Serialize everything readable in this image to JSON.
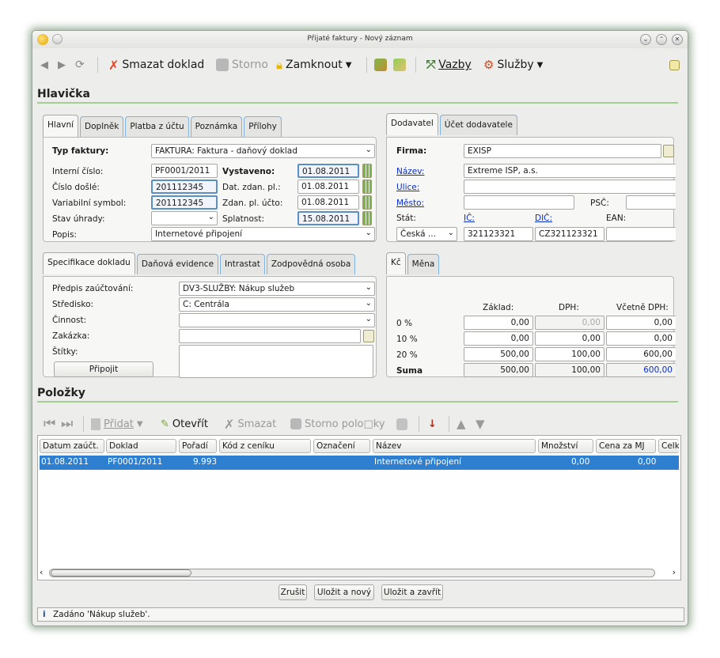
{
  "window": {
    "title": "Přijaté faktury - Nový záznam"
  },
  "toolbar": {
    "delete": "Smazat doklad",
    "storno": "Storno",
    "lock": "Zamknout",
    "links": "Vazby",
    "services": "Služby"
  },
  "header": {
    "title": "Hlavička",
    "left_tabs": [
      "Hlavní",
      "Doplněk",
      "Platba z účtu",
      "Poznámka",
      "Přílohy"
    ],
    "right_tabs": [
      "Dodavatel",
      "Účet dodavatele"
    ],
    "fields": {
      "typ_label": "Typ faktury:",
      "typ_value": "FAKTURA: Faktura - daňový doklad",
      "interni_label": "Interní číslo:",
      "interni_value": "PF0001/2011",
      "vystaveno_label": "Vystaveno:",
      "vystaveno_value": "01.08.2011",
      "cislo_dosle_label": "Číslo došlé:",
      "cislo_dosle_value": "201112345",
      "dat_zdan_label": "Dat. zdan. pl.:",
      "dat_zdan_value": "01.08.2011",
      "vs_label": "Variabilní symbol:",
      "vs_value": "201112345",
      "zdan_ucto_label": "Zdan. pl. účto:",
      "zdan_ucto_value": "01.08.2011",
      "stav_label": "Stav úhrady:",
      "stav_value": "",
      "splatnost_label": "Splatnost:",
      "splatnost_value": "15.08.2011",
      "popis_label": "Popis:",
      "popis_value": "Internetové připojení"
    },
    "supplier": {
      "firma_label": "Firma:",
      "firma_value": "EXISP",
      "nazev_label": "Název:",
      "nazev_value": "Extreme ISP, a.s.",
      "ulice_label": "Ulice:",
      "mesto_label": "Město:",
      "psc_label": "PSČ:",
      "stat_label": "Stát:",
      "ic_label": "IČ:",
      "dic_label": "DIČ:",
      "ean_label": "EAN:",
      "stat_value": "Česká ...",
      "ic_value": "321123321",
      "dic_value": "CZ321123321"
    },
    "spec_tabs": [
      "Specifikace dokladu",
      "Daňová evidence",
      "Intrastat",
      "Zodpovědná osoba"
    ],
    "spec": {
      "predpis_label": "Předpis zaúčtování:",
      "predpis_value": "DV3-SLUŽBY: Nákup služeb",
      "stredisko_label": "Středisko:",
      "stredisko_value": "C: Centrála",
      "cinnost_label": "Činnost:",
      "zakazka_label": "Zakázka:",
      "stitky_label": "Štítky:",
      "pripojit": "Připojit"
    },
    "vat_tabs": [
      "Kč",
      "Měna"
    ],
    "vat": {
      "col_zaklad": "Základ:",
      "col_dph": "DPH:",
      "col_celkem": "Včetně DPH:",
      "rows": [
        {
          "label": "0 %",
          "zaklad": "0,00",
          "dph": "0,00",
          "celkem": "0,00"
        },
        {
          "label": "10 %",
          "zaklad": "0,00",
          "dph": "0,00",
          "celkem": "0,00"
        },
        {
          "label": "20 %",
          "zaklad": "500,00",
          "dph": "100,00",
          "celkem": "600,00"
        },
        {
          "label": "Suma",
          "zaklad": "500,00",
          "dph": "100,00",
          "celkem": "600,00"
        }
      ]
    }
  },
  "items": {
    "title": "Položky",
    "toolbar": {
      "add": "Přidat",
      "open": "Otevřít",
      "delete": "Smazat",
      "storno": "Storno polo□ky"
    },
    "columns": [
      "Datum zaúčt.",
      "Doklad",
      "Pořadí",
      "Kód z ceníku",
      "Označení",
      "Název",
      "Množství",
      "Cena za MJ",
      "Celk"
    ],
    "rows": [
      {
        "datum": "01.08.2011",
        "doklad": "PF0001/2011",
        "poradi": "9.993",
        "kod": "",
        "oznaceni": "",
        "nazev": "Internetové připojení",
        "mnozstvi": "0,00",
        "cena": "0,00"
      }
    ]
  },
  "buttons": {
    "cancel": "Zrušit",
    "save_new": "Uložit a nový",
    "save_close": "Uložit a zavřít"
  },
  "status": {
    "text": "Zadáno 'Nákup služeb'."
  },
  "colors": {
    "accent": "#2f7fd0",
    "section_line": "#9fd08f",
    "link": "#0a2fc8"
  }
}
